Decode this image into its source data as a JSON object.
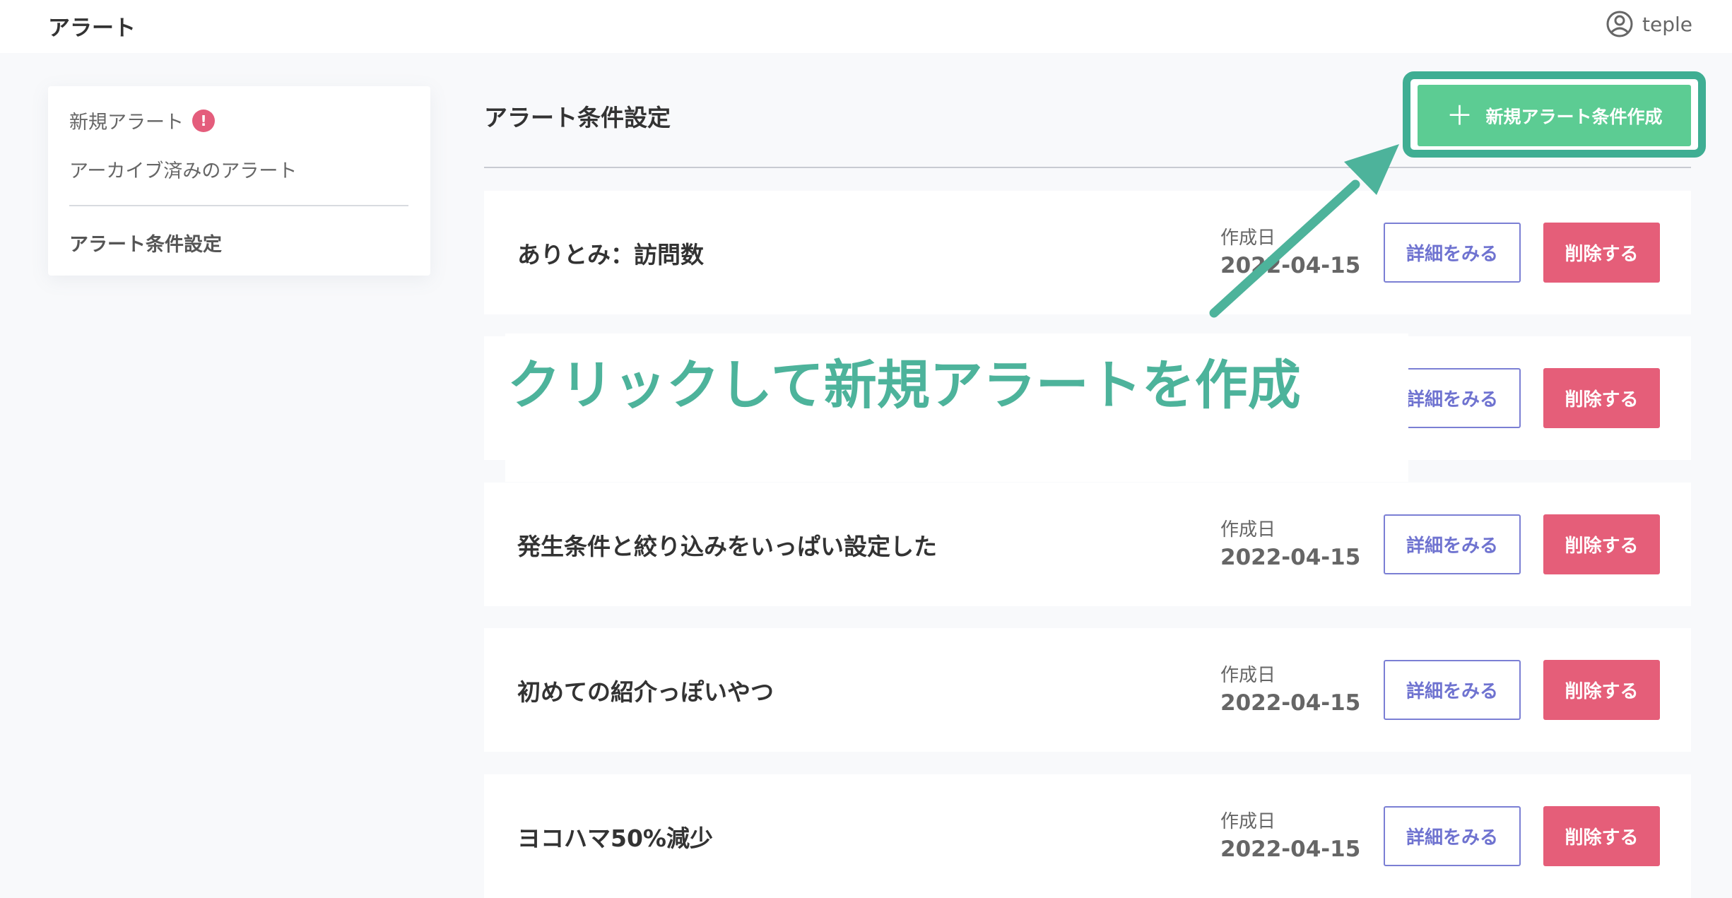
{
  "header": {
    "app_title": "アラート",
    "user_name": "teple"
  },
  "sidebar": {
    "new_alerts": "新規アラート",
    "new_alerts_badge": "!",
    "archived_alerts": "アーカイブ済みのアラート",
    "condition_settings": "アラート条件設定"
  },
  "main": {
    "title": "アラート条件設定",
    "create_button_label": "新規アラート条件作成",
    "create_button_icon": "plus-icon",
    "date_label": "作成日",
    "detail_button_label": "詳細をみる",
    "delete_button_label": "削除する",
    "rows": [
      {
        "title": "ありとみ：訪問数",
        "date": "2022-04-15"
      },
      {
        "title": "",
        "date": ""
      },
      {
        "title": "発生条件と絞り込みをいっぱい設定した",
        "date": "2022-04-15"
      },
      {
        "title": "初めての紹介っぽいやつ",
        "date": "2022-04-15"
      },
      {
        "title": "ヨコハマ50%減少",
        "date": "2022-04-15"
      }
    ]
  },
  "annotation": {
    "text": "クリックして新規アラートを作成",
    "color": "#4db39b"
  },
  "colors": {
    "create_button": "#5ccc93",
    "delete_button": "#e55e79",
    "detail_button": "#6f73d0",
    "badge": "#e45d7c"
  }
}
